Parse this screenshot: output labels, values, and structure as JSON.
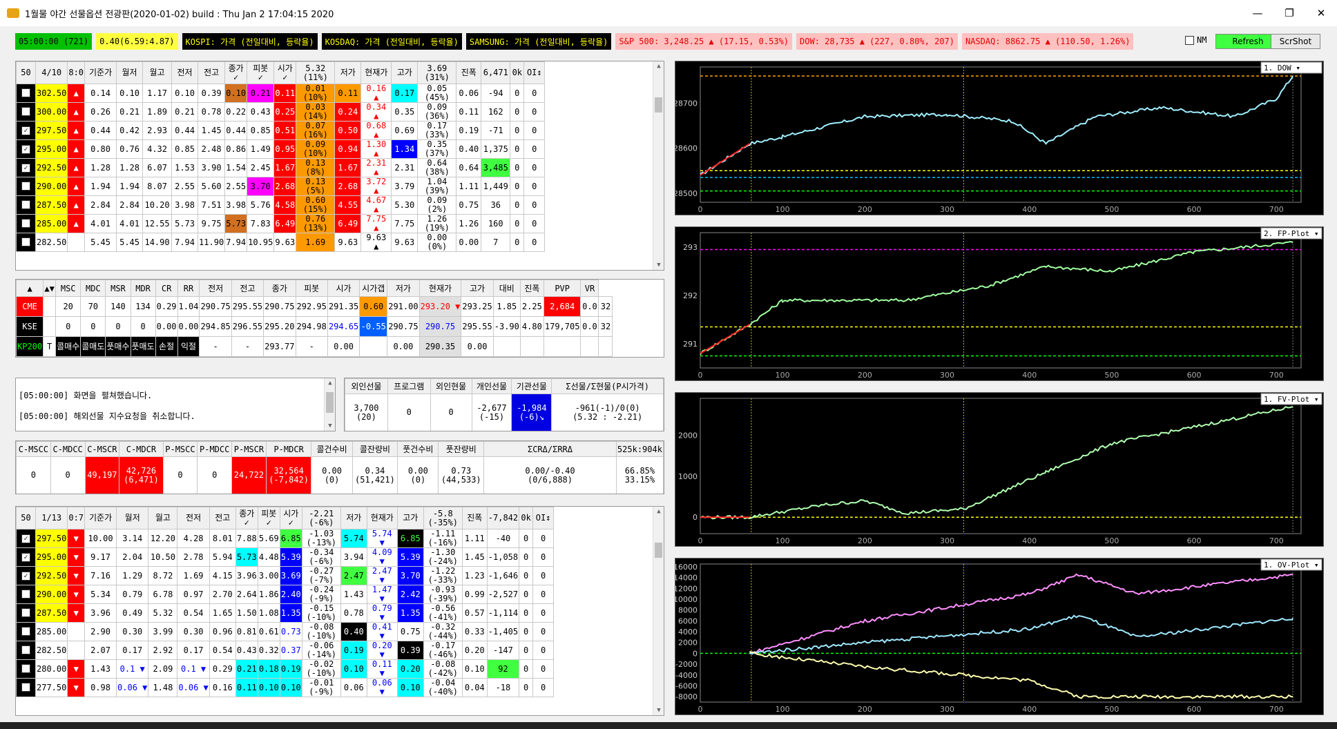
{
  "window": {
    "title": "1월물 야간 선물옵션 전광판(2020-01-02) build : Thu Jan  2 17:04:15 2020",
    "min": "—",
    "max": "❐",
    "close": "✕"
  },
  "topbar": {
    "time": "05:00:00 (721)",
    "ratio": "0.40(6.59:4.87)",
    "kospi": "KOSPI: 가격 (전일대비, 등락율)",
    "kosdaq": "KOSDAQ: 가격 (전일대비, 등락율)",
    "samsung": "SAMSUNG: 가격 (전일대비, 등락율)",
    "sp500": "S&P 500: 3,248.25 ▲ (17.15, 0.53%)",
    "dow": "DOW: 28,735 ▲ (227, 0.80%, 207)",
    "nasdaq": "NASDAQ: 8862.75 ▲ (110.50, 1.26%)",
    "nm_label": "NM",
    "refresh": "Refresh",
    "scrshot": "ScrShot"
  },
  "colors": {
    "green": "#00c000",
    "red": "#ff0000",
    "magenta": "#ff00ff",
    "orange": "#ff9900",
    "brown": "#d07020",
    "blue": "#0000ff",
    "cyan": "#00ffff",
    "lime": "#40ff40",
    "yellow": "#ffff00",
    "cyanlight": "#80ffff"
  },
  "call_table": {
    "headers": [
      "50",
      "4/10",
      "8:0",
      "기준가",
      "월저",
      "월고",
      "전저",
      "전고",
      "종가\n✓",
      "피봇\n✓",
      "시가\n✓",
      "5.32\n(11%)",
      "저가",
      "현재가",
      "고가",
      "3.69\n(31%)",
      "진폭",
      "6,471",
      "0k",
      "OI↕"
    ],
    "rows": [
      {
        "chk": false,
        "strike": "302.50",
        "m": "▲",
        "v": [
          "0.14",
          "0.10",
          "1.17",
          "0.10",
          "0.39",
          "0.10",
          "0.21",
          "0.11",
          "0.01\n(10%)",
          "0.11",
          "0.16\n▲",
          "0.17",
          "0.05\n(45%)",
          "0.06",
          "-94",
          "0",
          "0"
        ],
        "bg": {
          "5": "brown",
          "6": "magenta",
          "7": "red",
          "8": "orange",
          "9": "orange",
          "11": "cyan"
        },
        "fg": {
          "10": "red"
        }
      },
      {
        "chk": false,
        "strike": "300.00",
        "m": "▲",
        "v": [
          "0.26",
          "0.21",
          "1.89",
          "0.21",
          "0.78",
          "0.22",
          "0.43",
          "0.25",
          "0.03\n(14%)",
          "0.24",
          "0.34\n▲",
          "0.35",
          "0.09\n(36%)",
          "0.11",
          "162",
          "0",
          "0"
        ],
        "bg": {
          "7": "red",
          "8": "orange",
          "9": "red"
        },
        "fg": {
          "10": "red"
        }
      },
      {
        "chk": true,
        "strike": "297.50",
        "m": "▲",
        "v": [
          "0.44",
          "0.42",
          "2.93",
          "0.44",
          "1.45",
          "0.44",
          "0.85",
          "0.51",
          "0.07\n(16%)",
          "0.50",
          "0.68\n▲",
          "0.69",
          "0.17\n(33%)",
          "0.19",
          "-71",
          "0",
          "0"
        ],
        "bg": {
          "7": "red",
          "8": "orange",
          "9": "red"
        },
        "fg": {
          "10": "red"
        }
      },
      {
        "chk": true,
        "strike": "295.00",
        "m": "▲",
        "v": [
          "0.80",
          "0.76",
          "4.32",
          "0.85",
          "2.48",
          "0.86",
          "1.49",
          "0.95",
          "0.09\n(10%)",
          "0.94",
          "1.30\n▲",
          "1.34",
          "0.35\n(37%)",
          "0.40",
          "1,375",
          "0",
          "0"
        ],
        "bg": {
          "7": "red",
          "8": "orange",
          "9": "red",
          "11": "blue"
        },
        "fg": {
          "10": "red"
        }
      },
      {
        "chk": true,
        "strike": "292.50",
        "m": "▲",
        "v": [
          "1.28",
          "1.28",
          "6.07",
          "1.53",
          "3.90",
          "1.54",
          "2.45",
          "1.67",
          "0.13\n(8%)",
          "1.67",
          "2.31\n▲",
          "2.31",
          "0.64\n(38%)",
          "0.64",
          "3,485",
          "0",
          "0"
        ],
        "bg": {
          "7": "red",
          "8": "orange",
          "9": "red",
          "14": "lime"
        },
        "fg": {
          "10": "red"
        }
      },
      {
        "chk": false,
        "strike": "290.00",
        "m": "▲",
        "v": [
          "1.94",
          "1.94",
          "8.07",
          "2.55",
          "5.60",
          "2.55",
          "3.70",
          "2.68",
          "0.13\n(5%)",
          "2.68",
          "3.72\n▲",
          "3.79",
          "1.04\n(39%)",
          "1.11",
          "1,449",
          "0",
          "0"
        ],
        "bg": {
          "6": "magenta",
          "7": "red",
          "8": "orange",
          "9": "red"
        },
        "fg": {
          "10": "red"
        }
      },
      {
        "chk": false,
        "strike": "287.50",
        "m": "▲",
        "v": [
          "2.84",
          "2.84",
          "10.20",
          "3.98",
          "7.51",
          "3.98",
          "5.76",
          "4.58",
          "0.60\n(15%)",
          "4.55",
          "4.67\n▲",
          "5.30",
          "0.09\n(2%)",
          "0.75",
          "36",
          "0",
          "0"
        ],
        "bg": {
          "7": "red",
          "8": "orange",
          "9": "red"
        },
        "fg": {
          "10": "red"
        }
      },
      {
        "chk": false,
        "strike": "285.00",
        "m": "▲",
        "v": [
          "4.01",
          "4.01",
          "12.55",
          "5.73",
          "9.75",
          "5.73",
          "7.83",
          "6.49",
          "0.76\n(13%)",
          "6.49",
          "7.75\n▲",
          "7.75",
          "1.26\n(19%)",
          "1.26",
          "160",
          "0",
          "0"
        ],
        "bg": {
          "5": "brown",
          "7": "red",
          "8": "orange",
          "9": "red"
        },
        "fg": {
          "10": "red"
        }
      },
      {
        "chk": false,
        "strike": "282.50",
        "m": "",
        "v": [
          "5.45",
          "5.45",
          "14.90",
          "7.94",
          "11.90",
          "7.94",
          "10.95",
          "9.63",
          "1.69",
          "9.63",
          "9.63\n▲",
          "9.63",
          "0.00\n(0%)",
          "0.00",
          "7",
          "0",
          "0"
        ],
        "bg": {
          "8": "orange"
        },
        "fg": {}
      }
    ]
  },
  "mid_table": {
    "headers": [
      "▲",
      "▲▼",
      "MSC",
      "MDC",
      "MSR",
      "MDR",
      "CR",
      "RR",
      "전저",
      "전고",
      "종가",
      "피봇",
      "시가",
      "시가갭",
      "저가",
      "현재가",
      "고가",
      "대비",
      "진폭",
      "PVP",
      "VR"
    ],
    "rows": [
      {
        "name": "CME",
        "v": [
          "",
          "20",
          "70",
          "140",
          "134",
          "0.29",
          "1.04",
          "290.75",
          "295.55",
          "290.75",
          "292.95",
          "291.35",
          "0.60",
          "291.00",
          "293.20 ▼",
          "293.25",
          "1.85",
          "2.25",
          "2,684",
          "0.0",
          "32"
        ]
      },
      {
        "name": "KSE",
        "v": [
          "",
          "0",
          "0",
          "0",
          "0",
          "0.00",
          "0.00",
          "294.85",
          "296.55",
          "295.20",
          "294.98",
          "294.65",
          "-0.55",
          "290.75",
          "290.75",
          "295.55",
          "-3.90",
          "4.80",
          "179,705",
          "0.0",
          "32"
        ]
      },
      {
        "name": "KP200",
        "v": [
          "T",
          "콜매수",
          "콜매도",
          "풋매수",
          "풋매도",
          "손절",
          "익절",
          "-",
          "-",
          "293.77",
          "-",
          "0.00",
          "",
          "0.00",
          "290.35",
          "0.00",
          "",
          "",
          "",
          "",
          ""
        ]
      }
    ]
  },
  "log": {
    "lines": [
      "[05:00:00] 화면을 펼쳐했습니다.",
      "[05:00:00] 해외선물 지수요청을 취소합니다."
    ]
  },
  "flow": {
    "headers": [
      "외인선물",
      "프로그램",
      "외인현물",
      "개인선물",
      "기관선물",
      "Σ선물/Σ현물(P시가격)"
    ],
    "values": [
      "3,700\n(20)",
      "0",
      "0",
      "-2,677\n(-15)",
      "-1,984\n(-6)↘",
      "-961(-1)/0(0)\n(5.32 : -2.21)"
    ]
  },
  "mscc": {
    "headers": [
      "C-MSCC",
      "C-MDCC",
      "C-MSCR",
      "C-MDCR",
      "P-MSCC",
      "P-MDCC",
      "P-MSCR",
      "P-MDCR",
      "콜건수비",
      "콜잔량비",
      "풋건수비",
      "풋잔량비",
      "ΣCRΔ/ΣRRΔ",
      "525k:904k"
    ],
    "values": [
      "0",
      "0",
      "49,197",
      "42,726\n(6,471)",
      "0",
      "0",
      "24,722",
      "32,564\n(-7,842)",
      "0.00\n(0)",
      "0.34\n(51,421)",
      "0.00\n(0)",
      "0.73\n(44,533)",
      "0.00/-0.40\n(0/6,888)",
      "66.85%\n33.15%"
    ]
  },
  "put_table": {
    "headers": [
      "50",
      "1/13",
      "0:7",
      "기준가",
      "월저",
      "월고",
      "전저",
      "전고",
      "종가\n✓",
      "피봇\n✓",
      "시가\n✓",
      "-2.21\n(-6%)",
      "저가",
      "현재가",
      "고가",
      "-5.8\n(-35%)",
      "진폭",
      "-7,842",
      "0k",
      "OI↕"
    ],
    "rows": [
      {
        "chk": true,
        "strike": "297.50",
        "m": "▼",
        "v": [
          "10.00",
          "3.14",
          "12.20",
          "4.28",
          "8.01",
          "7.88",
          "5.69",
          "6.85",
          "-1.03\n(-13%)",
          "5.74",
          "5.74\n▼",
          "6.85",
          "-1.11\n(-16%)",
          "1.11",
          "-40",
          "0",
          "0"
        ],
        "bg": {
          "7": "lime",
          "9": "cyan",
          "11": "black"
        },
        "fg": {
          "10": "blue",
          "11": "lime"
        }
      },
      {
        "chk": true,
        "strike": "295.00",
        "m": "▼",
        "v": [
          "9.17",
          "2.04",
          "10.50",
          "2.78",
          "5.94",
          "5.73",
          "4.48",
          "5.39",
          "-0.34\n(-6%)",
          "3.94",
          "4.09\n▼",
          "5.39",
          "-1.30\n(-24%)",
          "1.45",
          "-1,058",
          "0",
          "0"
        ],
        "bg": {
          "5": "cyan",
          "7": "blue",
          "11": "blue"
        },
        "fg": {
          "10": "blue"
        }
      },
      {
        "chk": true,
        "strike": "292.50",
        "m": "▼",
        "v": [
          "7.16",
          "1.29",
          "8.72",
          "1.69",
          "4.15",
          "3.96",
          "3.00",
          "3.69",
          "-0.27\n(-7%)",
          "2.47",
          "2.47\n▼",
          "3.70",
          "-1.22\n(-33%)",
          "1.23",
          "-1,646",
          "0",
          "0"
        ],
        "bg": {
          "7": "blue",
          "9": "lime",
          "11": "blue"
        },
        "fg": {
          "10": "blue"
        }
      },
      {
        "chk": false,
        "strike": "290.00",
        "m": "▼",
        "v": [
          "5.34",
          "0.79",
          "6.78",
          "0.97",
          "2.70",
          "2.64",
          "1.86",
          "2.40",
          "-0.24\n(-9%)",
          "1.43",
          "1.47\n▼",
          "2.42",
          "-0.93\n(-39%)",
          "0.99",
          "-2,527",
          "0",
          "0"
        ],
        "bg": {
          "7": "blue",
          "11": "blue"
        },
        "fg": {
          "10": "blue"
        }
      },
      {
        "chk": false,
        "strike": "287.50",
        "m": "▼",
        "v": [
          "3.96",
          "0.49",
          "5.32",
          "0.54",
          "1.65",
          "1.50",
          "1.08",
          "1.35",
          "-0.15\n(-10%)",
          "0.78",
          "0.79\n▼",
          "1.35",
          "-0.56\n(-41%)",
          "0.57",
          "-1,114",
          "0",
          "0"
        ],
        "bg": {
          "7": "blue",
          "11": "blue"
        },
        "fg": {
          "10": "blue"
        }
      },
      {
        "chk": false,
        "strike": "285.00",
        "m": "",
        "v": [
          "2.90",
          "0.30",
          "3.99",
          "0.30",
          "0.96",
          "0.81",
          "0.61",
          "0.73",
          "-0.08\n(-10%)",
          "0.40",
          "0.41\n▼",
          "0.75",
          "-0.32\n(-44%)",
          "0.33",
          "-1,405",
          "0",
          "0"
        ],
        "bg": {
          "9": "black"
        },
        "fg": {
          "7": "blue",
          "10": "blue",
          "9": "white"
        }
      },
      {
        "chk": false,
        "strike": "282.50",
        "m": "",
        "v": [
          "2.07",
          "0.17",
          "2.92",
          "0.17",
          "0.54",
          "0.43",
          "0.32",
          "0.37",
          "-0.06\n(-14%)",
          "0.19",
          "0.20\n▼",
          "0.39",
          "-0.17\n(-46%)",
          "0.20",
          "-147",
          "0",
          "0"
        ],
        "bg": {
          "9": "cyan",
          "11": "black"
        },
        "fg": {
          "7": "blue",
          "10": "blue",
          "11": "white"
        }
      },
      {
        "chk": false,
        "strike": "280.00",
        "m": "▼",
        "v": [
          "1.43",
          "0.1 ▼",
          "2.09",
          "0.1 ▼",
          "0.29",
          "0.21",
          "0.18",
          "0.19",
          "-0.02\n(-10%)",
          "0.10",
          "0.11\n▼",
          "0.20",
          "-0.08\n(-42%)",
          "0.10",
          "92",
          "0",
          "0"
        ],
        "bg": {
          "5": "cyan",
          "6": "cyan",
          "7": "cyan",
          "9": "cyan",
          "11": "cyan",
          "14": "lime"
        },
        "fg": {
          "1": "blue",
          "3": "blue",
          "10": "blue"
        }
      },
      {
        "chk": false,
        "strike": "277.50",
        "m": "▼",
        "v": [
          "0.98",
          "0.06 ▼",
          "1.48",
          "0.06 ▼",
          "0.16",
          "0.11",
          "0.10",
          "0.10",
          "-0.01\n(-9%)",
          "0.06",
          "0.06\n▼",
          "0.10",
          "-0.04\n(-40%)",
          "0.04",
          "-18",
          "0",
          "0"
        ],
        "bg": {
          "5": "cyan",
          "6": "cyan",
          "7": "cyan",
          "11": "cyan"
        },
        "fg": {
          "1": "blue",
          "3": "blue",
          "10": "blue"
        }
      }
    ]
  },
  "charts": [
    {
      "label": "1. DOW ▾",
      "ymin": 28480,
      "ymax": 28780,
      "yticks": [
        "28500",
        "28600",
        "28700"
      ],
      "ytickvals": [
        28500,
        28600,
        28700
      ],
      "xticks": [
        "0",
        "100",
        "200",
        "300",
        "400",
        "500",
        "600",
        "700"
      ],
      "hlines": [
        {
          "y": 28760,
          "c": "#ffa500"
        },
        {
          "y": 28550,
          "c": "#ffff00"
        },
        {
          "y": 28535,
          "c": "#00bfff"
        },
        {
          "y": 28505,
          "c": "#00ff00"
        }
      ]
    },
    {
      "label": "2. FP-Plot ▾",
      "ymin": 290.5,
      "ymax": 293.3,
      "yticks": [
        "291",
        "292",
        "293"
      ],
      "ytickvals": [
        291,
        292,
        293
      ],
      "xticks": [
        "0",
        "100",
        "200",
        "300",
        "400",
        "500",
        "600",
        "700"
      ],
      "hlines": [
        {
          "y": 292.95,
          "c": "#ff00ff"
        },
        {
          "y": 291.35,
          "c": "#ffff00"
        },
        {
          "y": 290.75,
          "c": "#00ff00"
        }
      ]
    },
    {
      "label": "1. FV-Plot ▾",
      "ymin": -400,
      "ymax": 2900,
      "yticks": [
        "0",
        "1000",
        "2000"
      ],
      "ytickvals": [
        0,
        1000,
        2000
      ],
      "xticks": [
        "0",
        "100",
        "200",
        "300",
        "400",
        "500",
        "600",
        "700"
      ],
      "hlines": [
        {
          "y": 0,
          "c": "#ffff00"
        }
      ]
    },
    {
      "label": "1. OV-Plot ▾",
      "ymin": -9000,
      "ymax": 16500,
      "yticks": [
        "-8000",
        "-6000",
        "-4000",
        "-2000",
        "0",
        "2000",
        "4000",
        "6000",
        "8000",
        "10000",
        "12000",
        "14000",
        "16000"
      ],
      "ytickvals": [
        -8000,
        -6000,
        -4000,
        -2000,
        0,
        2000,
        4000,
        6000,
        8000,
        10000,
        12000,
        14000,
        16000
      ],
      "xticks": [
        "0",
        "100",
        "200",
        "300",
        "400",
        "500",
        "600",
        "700"
      ],
      "hlines": [
        {
          "y": 0,
          "c": "#00ff00"
        }
      ]
    }
  ]
}
